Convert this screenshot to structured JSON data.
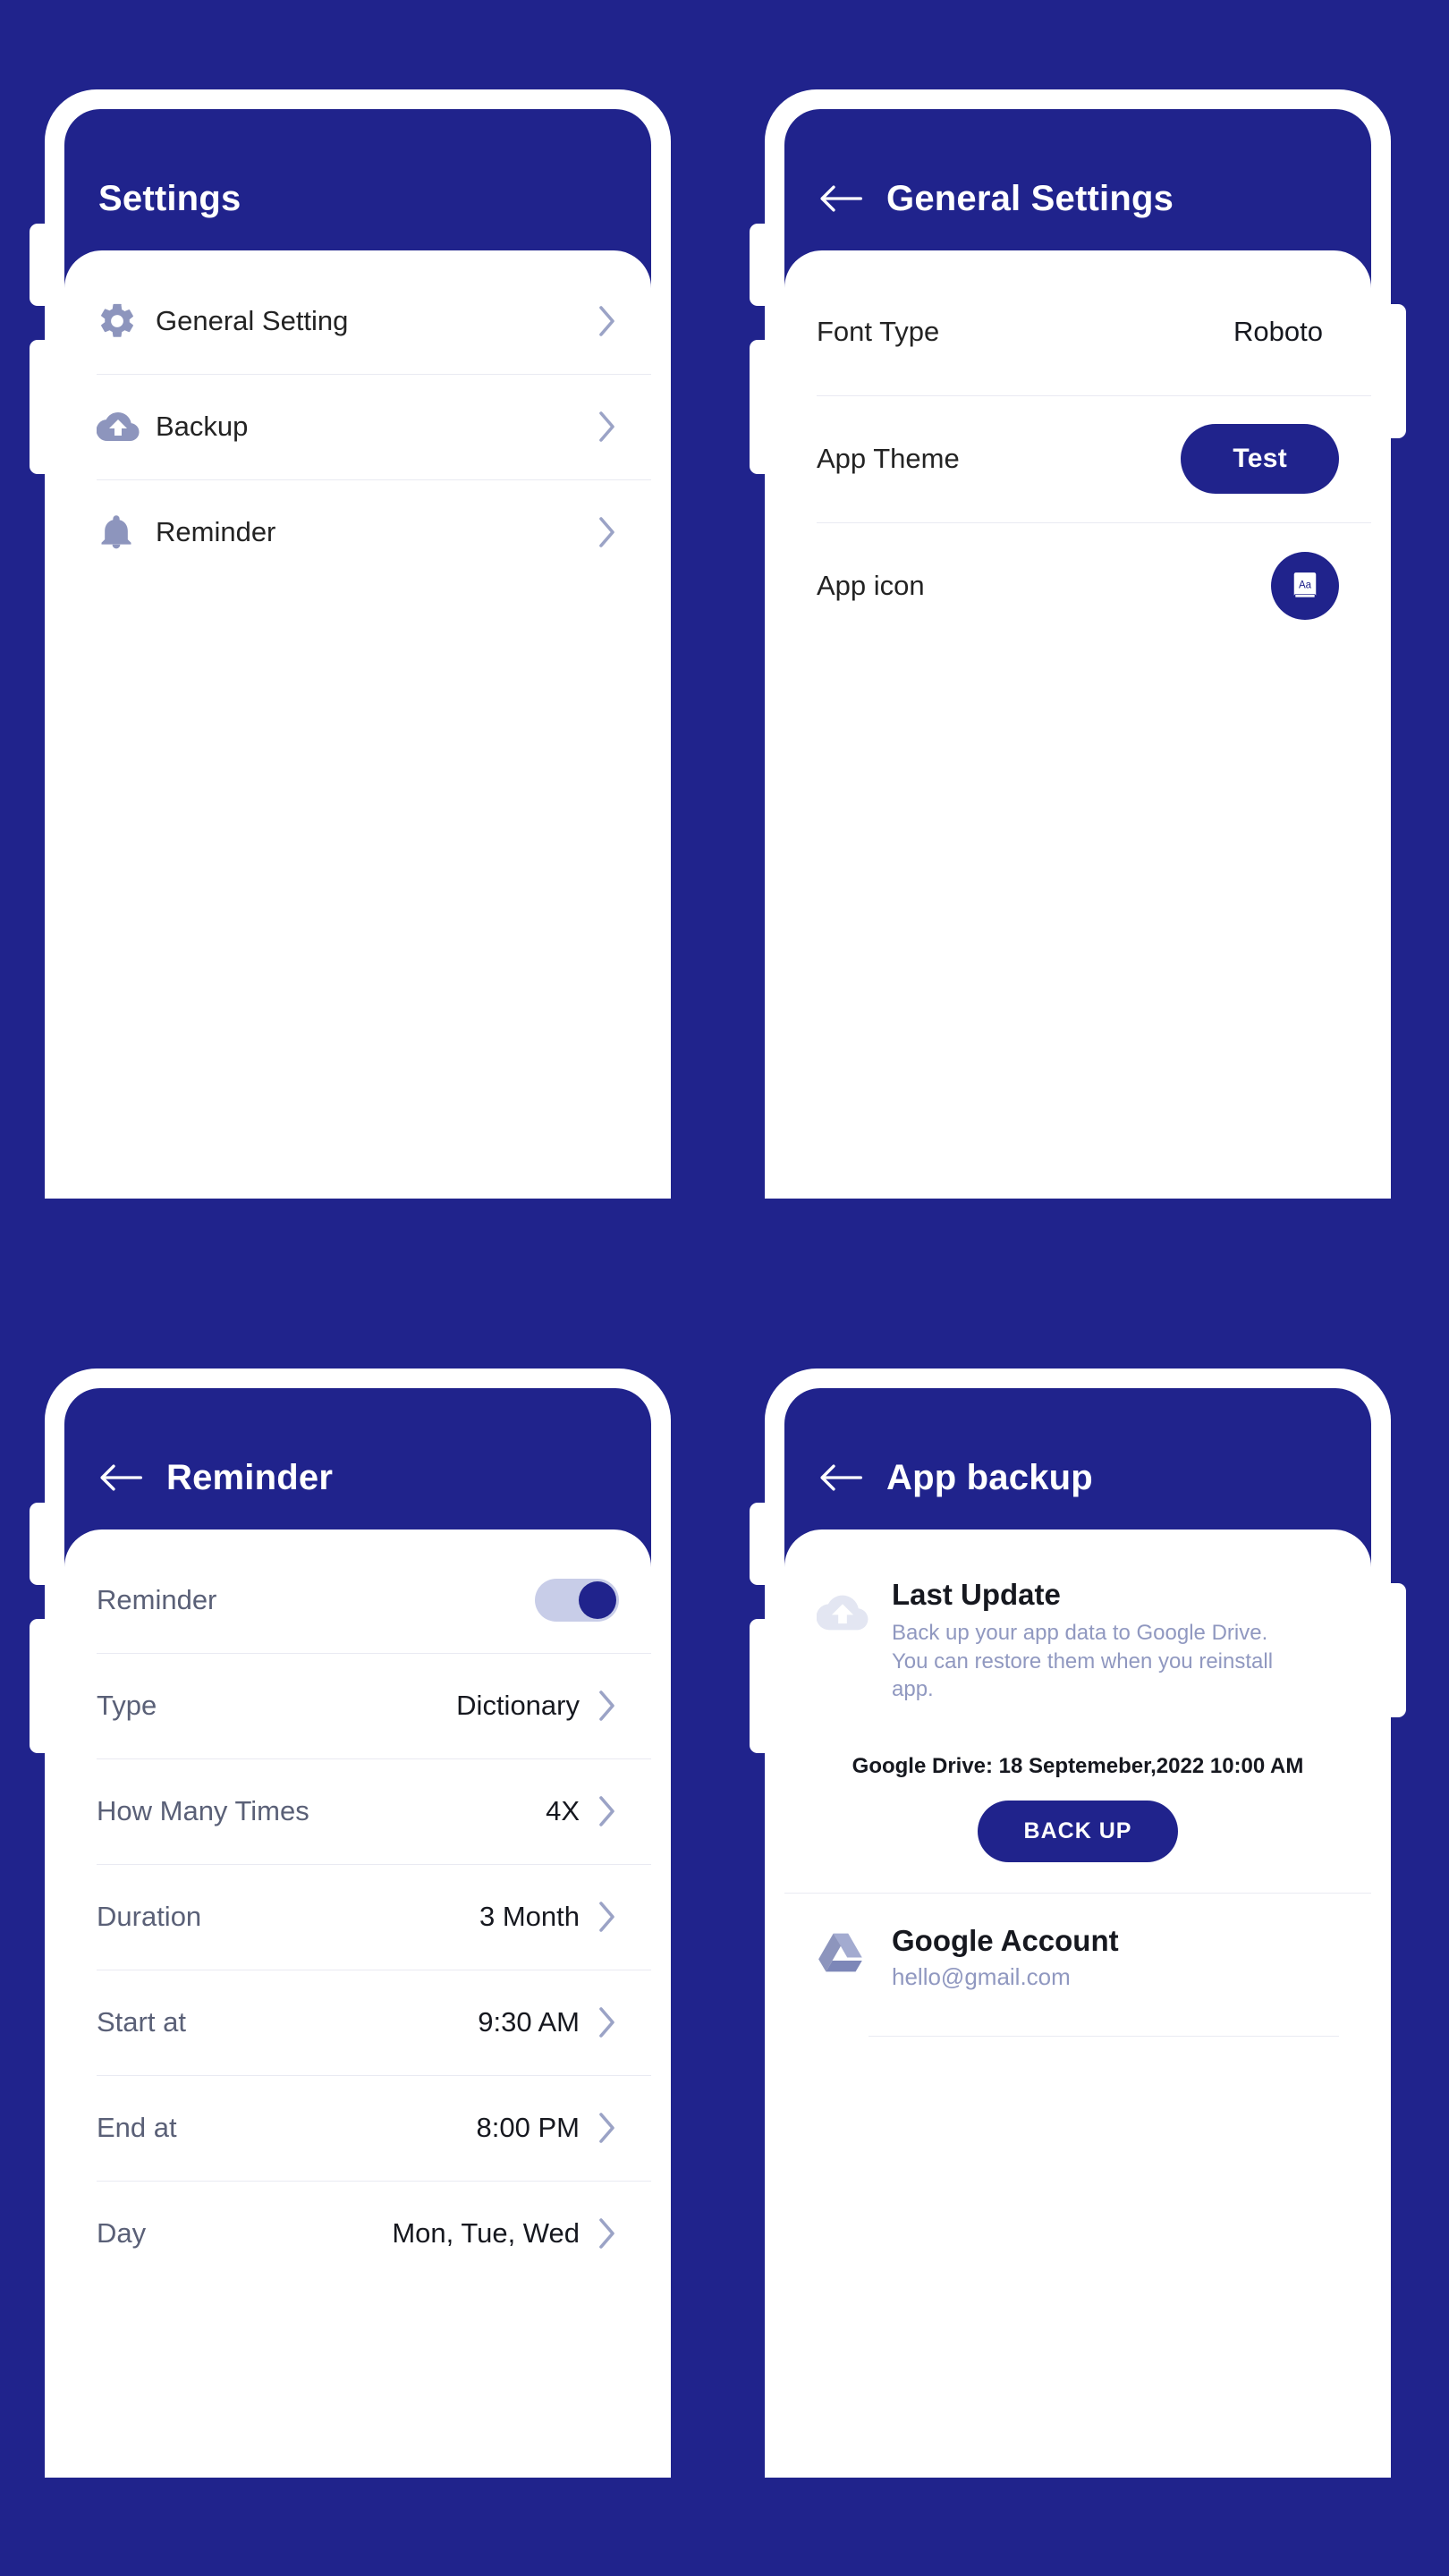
{
  "theme": {
    "background": "#20238c",
    "primary": "#20238c",
    "surface": "#ffffff",
    "icon_muted": "#8d95bd",
    "text_primary": "#16181f",
    "text_muted": "#9098c0",
    "divider": "#e9eaf2",
    "toggle_track": "#c8cde8"
  },
  "screens": [
    {
      "id": "settings",
      "appbar": {
        "title": "Settings",
        "has_back": false,
        "back_icon": "arrow-left-icon"
      },
      "rows": [
        {
          "icon": "gear-icon",
          "label": "General Setting",
          "value": "",
          "chevron": "chevron-right-icon"
        },
        {
          "icon": "cloud-upload-icon",
          "label": "Backup",
          "value": "",
          "chevron": "chevron-right-icon"
        },
        {
          "icon": "bell-icon",
          "label": "Reminder",
          "value": "",
          "chevron": "chevron-right-icon"
        }
      ]
    },
    {
      "id": "general-settings",
      "appbar": {
        "title": "General Settings",
        "has_back": true,
        "back_icon": "arrow-left-icon"
      },
      "rows": [
        {
          "label": "Font Type",
          "value": "Roboto",
          "control": "text"
        },
        {
          "label": "App Theme",
          "value": "Test",
          "control": "pill-button"
        },
        {
          "label": "App icon",
          "value": "Aa",
          "control": "app-icon-circle",
          "icon": "dictionary-book-icon"
        }
      ]
    },
    {
      "id": "reminder",
      "appbar": {
        "title": "Reminder",
        "has_back": true,
        "back_icon": "arrow-left-icon"
      },
      "rows": [
        {
          "label": "Reminder",
          "value": "",
          "control": "toggle",
          "toggle_on": true
        },
        {
          "label": "Type",
          "value": "Dictionary",
          "control": "chevron",
          "chevron": "chevron-right-icon"
        },
        {
          "label": "How Many Times",
          "value": "4X",
          "control": "chevron",
          "chevron": "chevron-right-icon"
        },
        {
          "label": "Duration",
          "value": "3 Month",
          "control": "chevron",
          "chevron": "chevron-right-icon"
        },
        {
          "label": "Start at",
          "value": "9:30 AM",
          "control": "chevron",
          "chevron": "chevron-right-icon"
        },
        {
          "label": "End at",
          "value": "8:00 PM",
          "control": "chevron",
          "chevron": "chevron-right-icon"
        },
        {
          "label": "Day",
          "value": "Mon, Tue, Wed",
          "control": "chevron",
          "chevron": "chevron-right-icon"
        }
      ]
    },
    {
      "id": "app-backup",
      "appbar": {
        "title": "App backup",
        "has_back": true,
        "back_icon": "arrow-left-icon"
      },
      "backup": {
        "icon": "cloud-upload-icon",
        "title": "Last Update",
        "description": "Back up your app data to Google Drive. You can restore them when you reinstall app.",
        "date_line": "Google Drive: 18 Septemeber,2022 10:00 AM",
        "button_label": "BACK UP"
      },
      "account": {
        "icon": "google-drive-icon",
        "name": "Google Account",
        "email": "hello@gmail.com"
      }
    }
  ]
}
